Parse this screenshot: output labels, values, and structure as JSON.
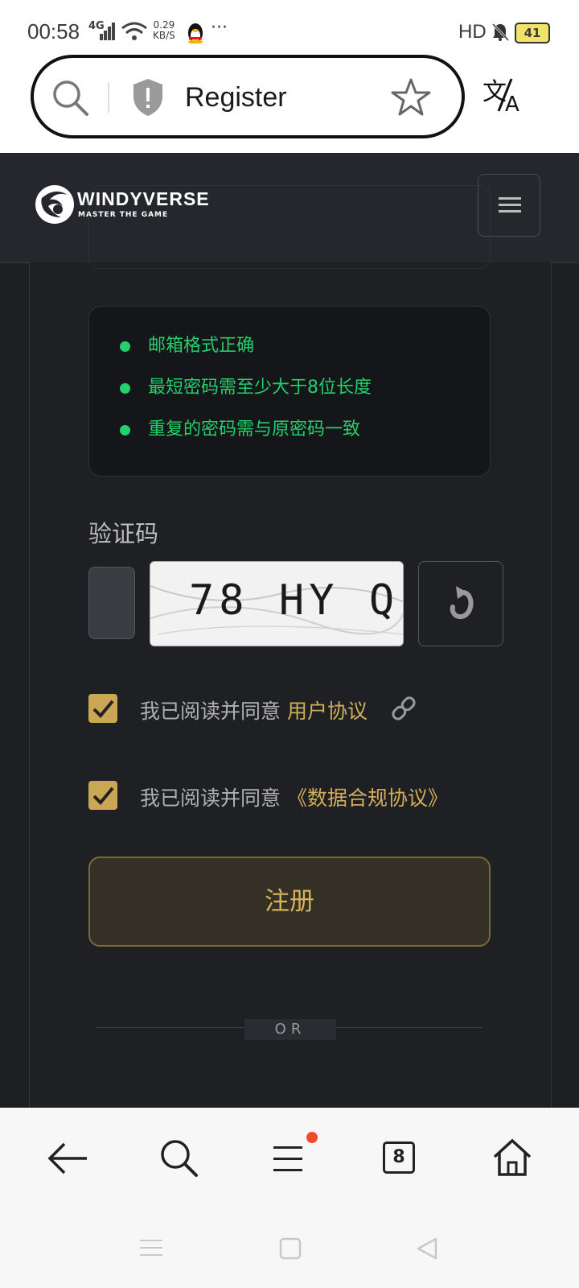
{
  "status_bar": {
    "time": "00:58",
    "network": "4G",
    "speed_value": "0.29",
    "speed_unit": "KB/S",
    "more": "···",
    "hd": "HD",
    "battery": "41"
  },
  "browser": {
    "page_title": "Register"
  },
  "site": {
    "logo_text": "WINDYVERSE",
    "logo_tagline": "MASTER THE GAME"
  },
  "form": {
    "rules": [
      "邮箱格式正确",
      "最短密码需至少大于8位长度",
      "重复的密码需与原密码一致"
    ],
    "captcha_label": "验证码",
    "captcha_text": "78 HY Q",
    "agree_prefix": "我已阅读并同意",
    "user_agreement": "用户协议",
    "data_agreement": "《数据合规协议》",
    "submit_label": "注册",
    "or_label": "OR"
  },
  "bottom_nav": {
    "tab_count": "8"
  },
  "colors": {
    "accent_gold": "#d1ad58",
    "rule_green": "#23d06c",
    "background": "#1e1f23"
  }
}
